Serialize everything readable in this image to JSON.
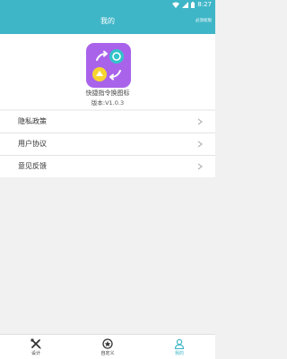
{
  "status_bar": {
    "time": "8:27",
    "icons": [
      "wifi-icon",
      "signal-icon",
      "battery-icon"
    ]
  },
  "header": {
    "title": "我的",
    "right_text": "必须权限"
  },
  "app": {
    "name": "快捷指令换图标",
    "version": "版本:V1.0.3"
  },
  "menu": {
    "items": [
      {
        "label": "隐私政策"
      },
      {
        "label": "用户协议"
      },
      {
        "label": "意见反馈"
      }
    ]
  },
  "tabbar": {
    "tabs": [
      {
        "label": "设计",
        "icon": "design-tools-icon"
      },
      {
        "label": "自定义",
        "icon": "custom-icon"
      },
      {
        "label": "我的",
        "icon": "person-icon"
      }
    ],
    "active_index": 2
  },
  "colors": {
    "accent": "#3fb6c7",
    "app_icon_bg": "#b95ce8",
    "app_icon_yellow": "#f7d531",
    "app_icon_teal": "#31c4c9"
  }
}
